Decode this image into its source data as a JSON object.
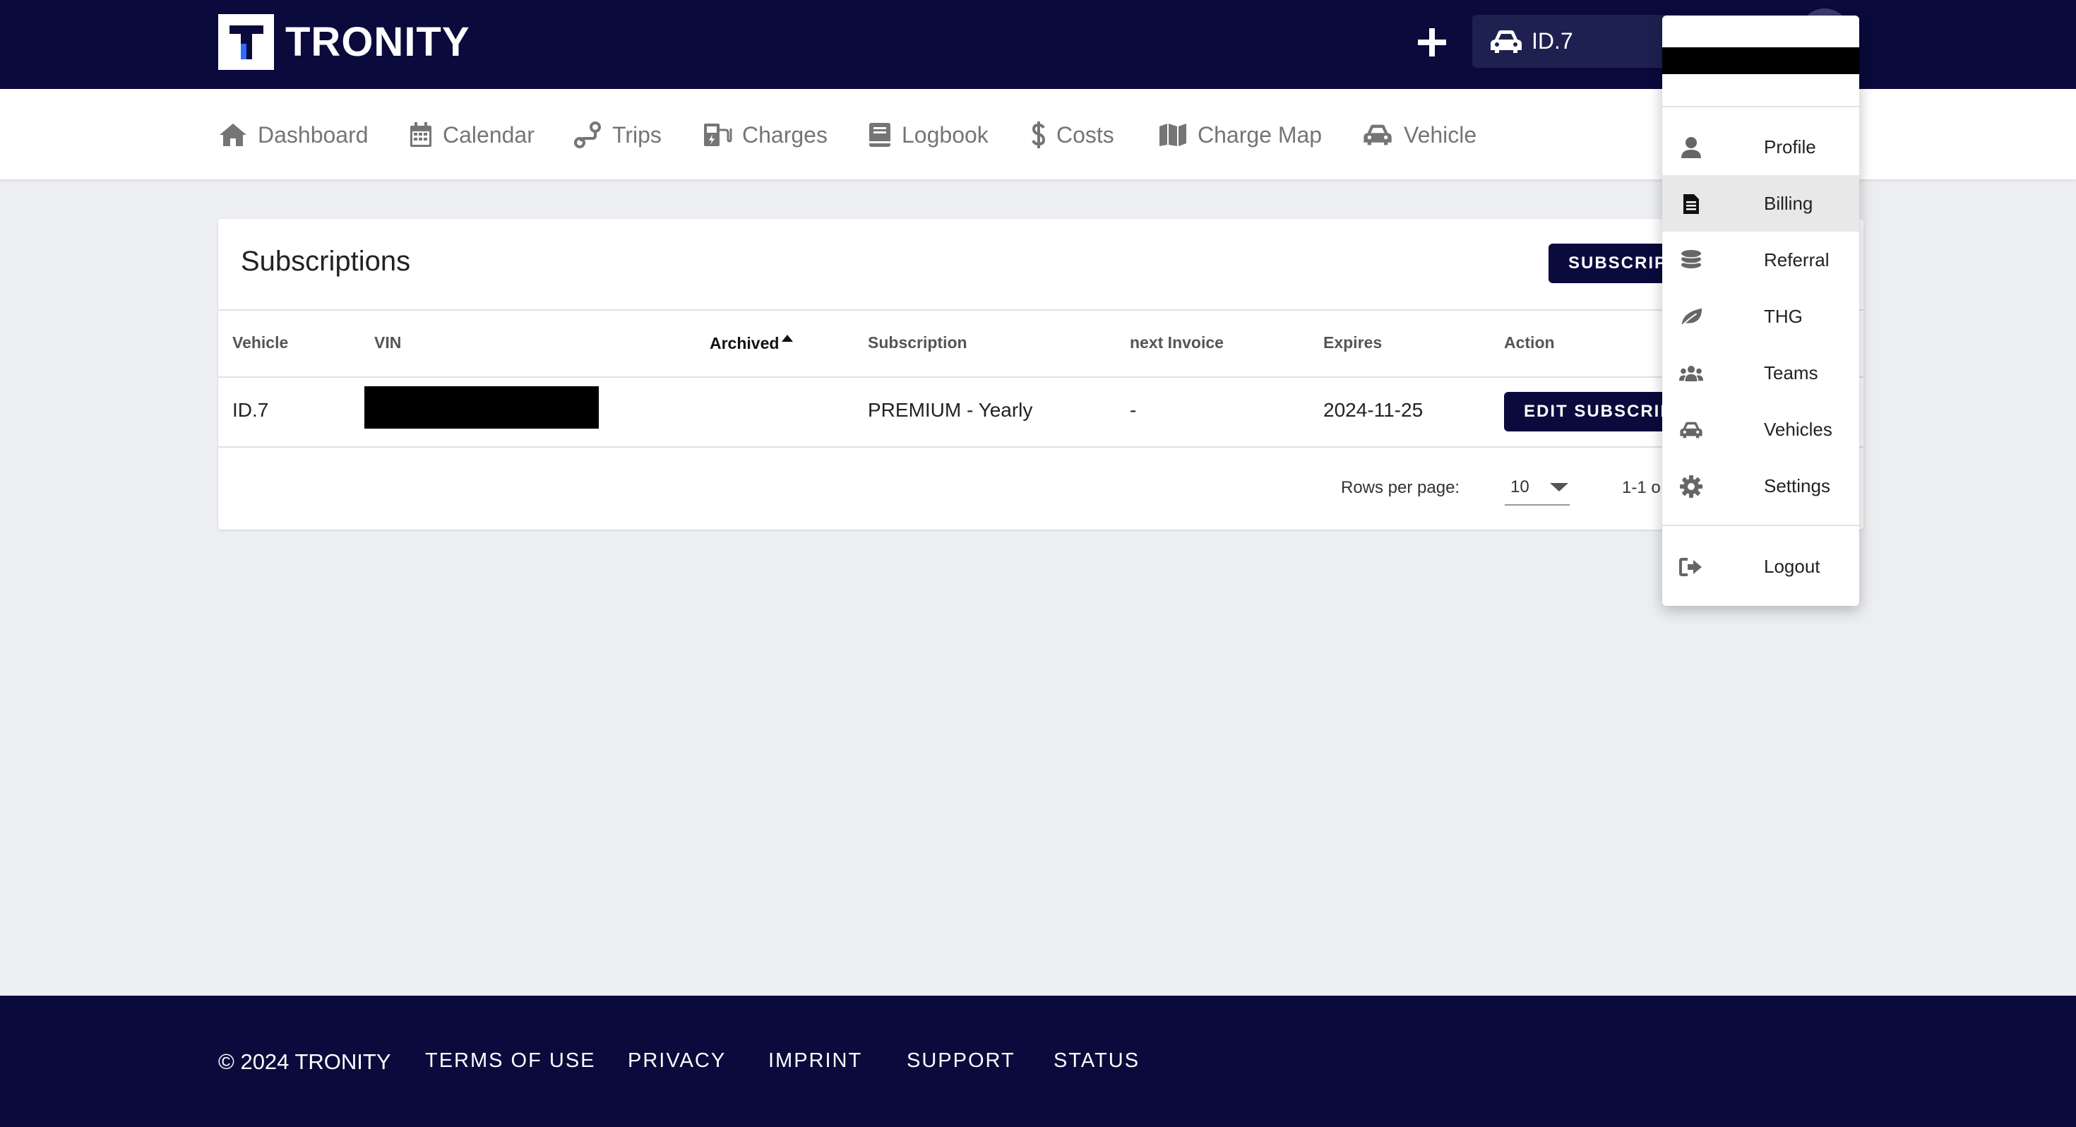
{
  "app": {
    "name": "TRONITY",
    "logo_letter": "T"
  },
  "header": {
    "vehicle_selected": "ID.7"
  },
  "nav": {
    "items": [
      {
        "label": "Dashboard",
        "icon": "home-icon"
      },
      {
        "label": "Calendar",
        "icon": "calendar-icon"
      },
      {
        "label": "Trips",
        "icon": "route-icon"
      },
      {
        "label": "Charges",
        "icon": "charging-station-icon"
      },
      {
        "label": "Logbook",
        "icon": "book-icon"
      },
      {
        "label": "Costs",
        "icon": "dollar-icon"
      },
      {
        "label": "Charge Map",
        "icon": "map-icon"
      },
      {
        "label": "Vehicle",
        "icon": "car-icon"
      }
    ]
  },
  "subscriptions": {
    "title": "Subscriptions",
    "subscribe_button": "SUBSCRIPT",
    "columns": [
      "Vehicle",
      "VIN",
      "Archived",
      "Subscription",
      "next Invoice",
      "Expires",
      "Action"
    ],
    "rows": [
      {
        "vehicle": "ID.7",
        "vin": "",
        "archived": "",
        "subscription": "PREMIUM - Yearly",
        "next_invoice": "-",
        "expires": "2024-11-25",
        "action": "EDIT SUBSCRIP"
      }
    ],
    "pagination": {
      "rows_per_page_label": "Rows per page:",
      "rows_per_page": "10",
      "range": "1-1 o"
    }
  },
  "user_menu": {
    "items": [
      {
        "label": "Profile",
        "icon": "person-icon"
      },
      {
        "label": "Billing",
        "icon": "invoice-icon",
        "selected": true
      },
      {
        "label": "Referral",
        "icon": "coins-icon"
      },
      {
        "label": "THG",
        "icon": "leaf-icon"
      },
      {
        "label": "Teams",
        "icon": "users-icon"
      },
      {
        "label": "Vehicles",
        "icon": "car-icon"
      },
      {
        "label": "Settings",
        "icon": "gear-icon"
      }
    ],
    "logout": {
      "label": "Logout",
      "icon": "logout-icon"
    }
  },
  "footer": {
    "copyright": "© 2024 TRONITY",
    "links": [
      "TERMS OF USE",
      "PRIVACY",
      "IMPRINT",
      "SUPPORT",
      "STATUS"
    ]
  },
  "colors": {
    "primary": "#0a0a3c",
    "background": "#eceef1",
    "accent_blue": "#2f6bff"
  }
}
